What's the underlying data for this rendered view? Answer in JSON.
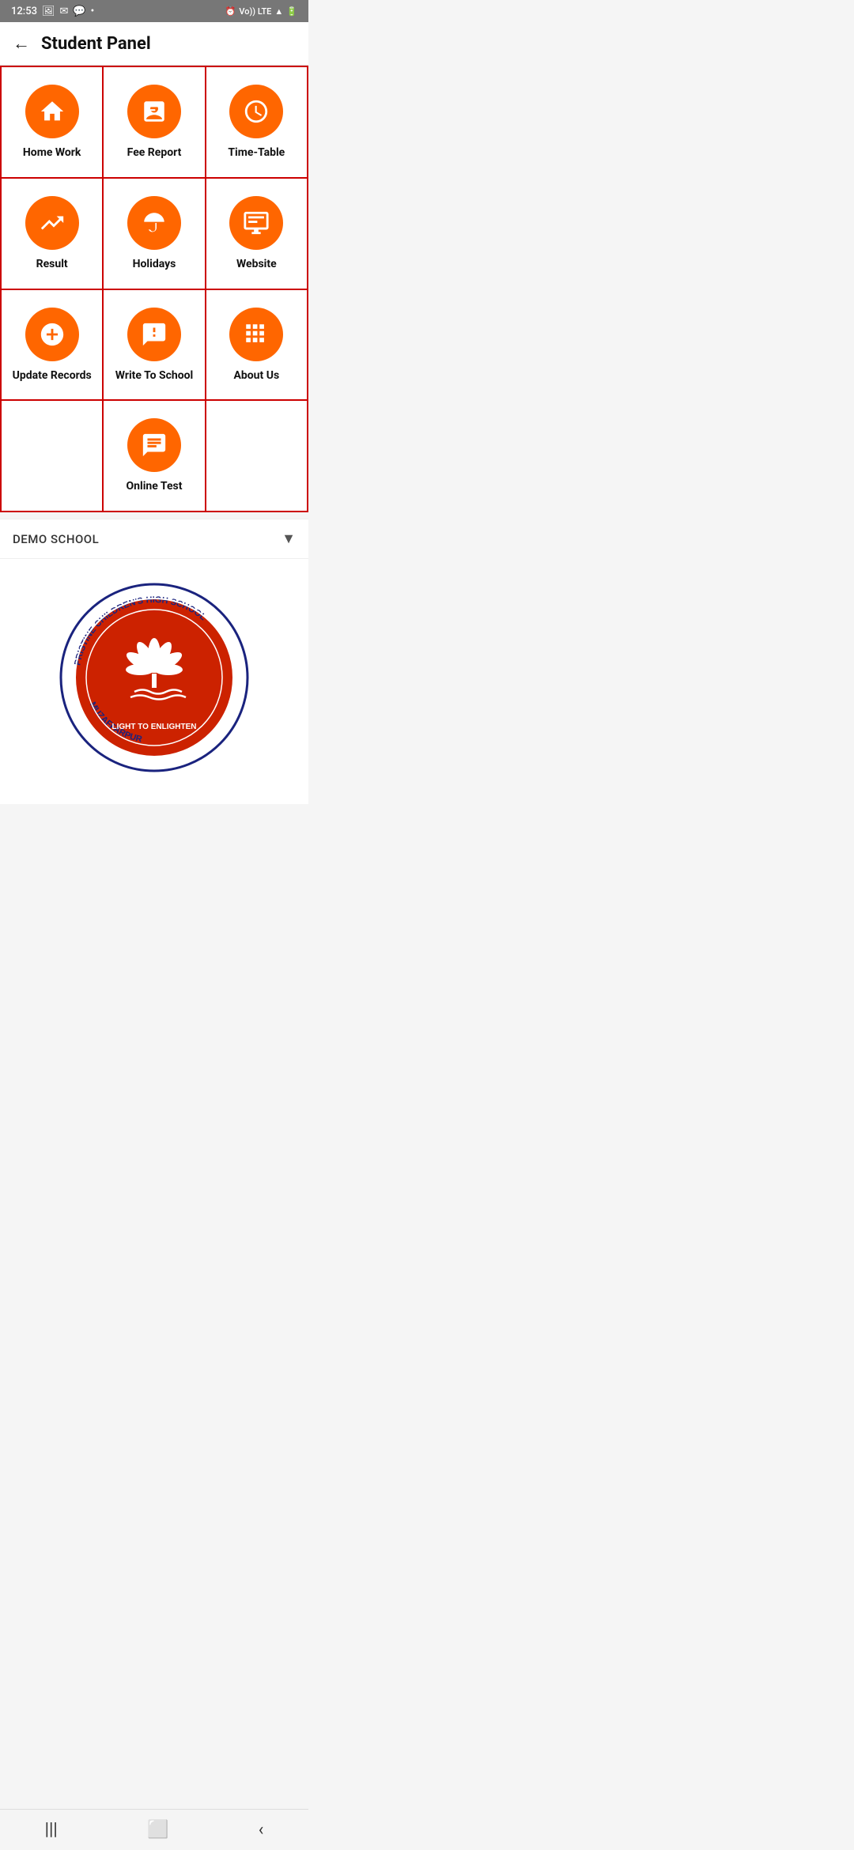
{
  "statusBar": {
    "time": "12:53",
    "rightIcons": "Vo)) LTE"
  },
  "header": {
    "backLabel": "←",
    "title": "Student Panel"
  },
  "grid": {
    "items": [
      {
        "id": "home-work",
        "label": "Home Work",
        "icon": "home"
      },
      {
        "id": "fee-report",
        "label": "Fee Report",
        "icon": "fee"
      },
      {
        "id": "time-table",
        "label": "Time-Table",
        "icon": "clock"
      },
      {
        "id": "result",
        "label": "Result",
        "icon": "chart"
      },
      {
        "id": "holidays",
        "label": "Holidays",
        "icon": "umbrella"
      },
      {
        "id": "website",
        "label": "Website",
        "icon": "monitor"
      },
      {
        "id": "update-records",
        "label": "Update Records",
        "icon": "plus"
      },
      {
        "id": "write-to-school",
        "label": "Write To School",
        "icon": "message-alert"
      },
      {
        "id": "about-us",
        "label": "About Us",
        "icon": "grid"
      },
      {
        "id": "empty1",
        "label": "",
        "icon": ""
      },
      {
        "id": "online-test",
        "label": "Online Test",
        "icon": "chat"
      },
      {
        "id": "empty2",
        "label": "",
        "icon": ""
      }
    ]
  },
  "dropdown": {
    "value": "DEMO SCHOOL"
  },
  "school": {
    "name": "PRISTINE CHILDREN'S HIGH SCHOOL",
    "motto": "LIGHT TO ENLIGHTEN",
    "location": "MUZAFFARPUR"
  },
  "navBar": {
    "items": [
      "menu",
      "home",
      "back"
    ]
  }
}
